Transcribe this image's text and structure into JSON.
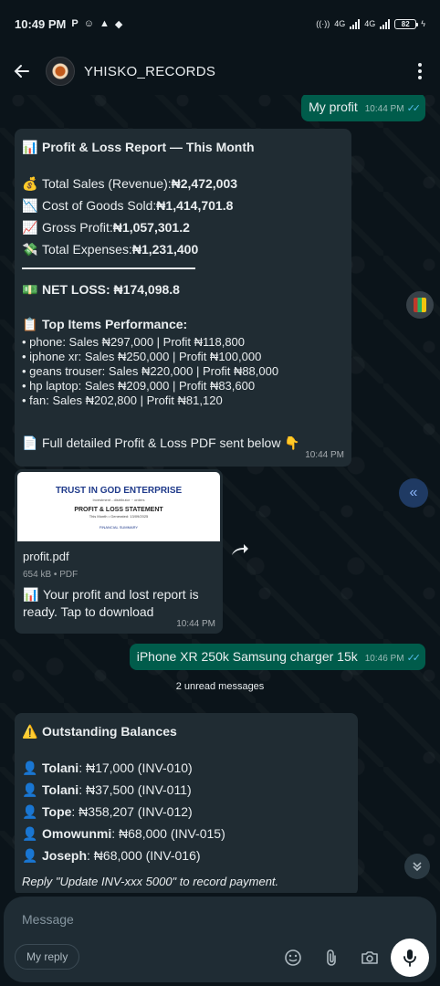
{
  "status_bar": {
    "time": "10:49 PM",
    "left_icons": [
      "P",
      "☺",
      "▲",
      "◆"
    ],
    "battery": "82",
    "network": [
      "4G",
      "4G"
    ]
  },
  "header": {
    "title": "YHISKO_RECORDS"
  },
  "messages": {
    "m1": {
      "text": "My profit",
      "time": "10:44 PM",
      "ticks": "✓✓"
    },
    "m2": {
      "title": "Profit & Loss Report — This Month",
      "sales_label": "Total Sales (Revenue): ",
      "sales_value": "₦2,472,003",
      "cogs_label": "Cost of Goods Sold: ",
      "cogs_value": "₦1,414,701.8",
      "gross_label": "Gross Profit: ",
      "gross_value": "₦1,057,301.2",
      "exp_label": "Total Expenses: ",
      "exp_value": "₦1,231,400",
      "net": "NET LOSS: ₦174,098.8",
      "top_title": "Top Items Performance:",
      "items": [
        "• phone: Sales ₦297,000 | Profit ₦118,800",
        "• iphone xr: Sales ₦250,000 | Profit ₦100,000",
        "• geans trouser: Sales ₦220,000 | Profit ₦88,000",
        "• hp laptop: Sales ₦209,000 | Profit ₦83,600",
        "• fan: Sales ₦202,800 | Profit ₦81,120"
      ],
      "pdf_note": "Full detailed Profit & Loss PDF sent below 👇",
      "time": "10:44 PM"
    },
    "m3": {
      "thumb_title": "TRUST IN GOD ENTERPRISE",
      "thumb_sub": "Investment - distributor ·· orders",
      "thumb_statement": "PROFIT & LOSS STATEMENT",
      "thumb_period": "This Month • Generated: 13/09/2025",
      "thumb_summary": "FINANCIAL SUMMARY",
      "file_name": "profit.pdf",
      "file_meta": "654 kB • PDF",
      "caption": "Your profit and lost report is ready. Tap to download",
      "time": "10:44 PM"
    },
    "m4": {
      "text": "iPhone XR 250k Samsung charger 15k",
      "time": "10:46 PM",
      "ticks": "✓✓"
    },
    "unread_label": "2 unread messages",
    "m5": {
      "title": "Outstanding Balances",
      "balances": [
        {
          "name": "Tolani",
          "detail": ": ₦17,000 (INV-010)"
        },
        {
          "name": "Tolani",
          "detail": ": ₦37,500 (INV-011)"
        },
        {
          "name": "Tope",
          "detail": ": ₦358,207 (INV-012)"
        },
        {
          "name": "Omowunmi",
          "detail": ": ₦68,000 (INV-015)"
        },
        {
          "name": "Joseph",
          "detail": ": ₦68,000 (INV-016)"
        }
      ],
      "reply_hint": "Reply \"Update INV-xxx 5000\" to record payment."
    }
  },
  "composer": {
    "placeholder": "Message",
    "reply_chip": "My reply"
  },
  "colors": {
    "background": "#0b141a",
    "outgoing_bubble": "#005c4b",
    "incoming_bubble": "#202c33",
    "read_ticks": "#53bdeb"
  },
  "icons": [
    "back-arrow-icon",
    "menu-dots-icon",
    "chart-icon",
    "money-bag-icon",
    "chart-down-icon",
    "chart-up-icon",
    "money-wings-icon",
    "banknote-icon",
    "clipboard-icon",
    "document-icon",
    "forward-icon",
    "warning-icon",
    "person-icon",
    "sticker-icon",
    "attach-icon",
    "camera-icon",
    "mic-icon",
    "chevron-double-left-icon",
    "chevron-double-down-icon"
  ]
}
